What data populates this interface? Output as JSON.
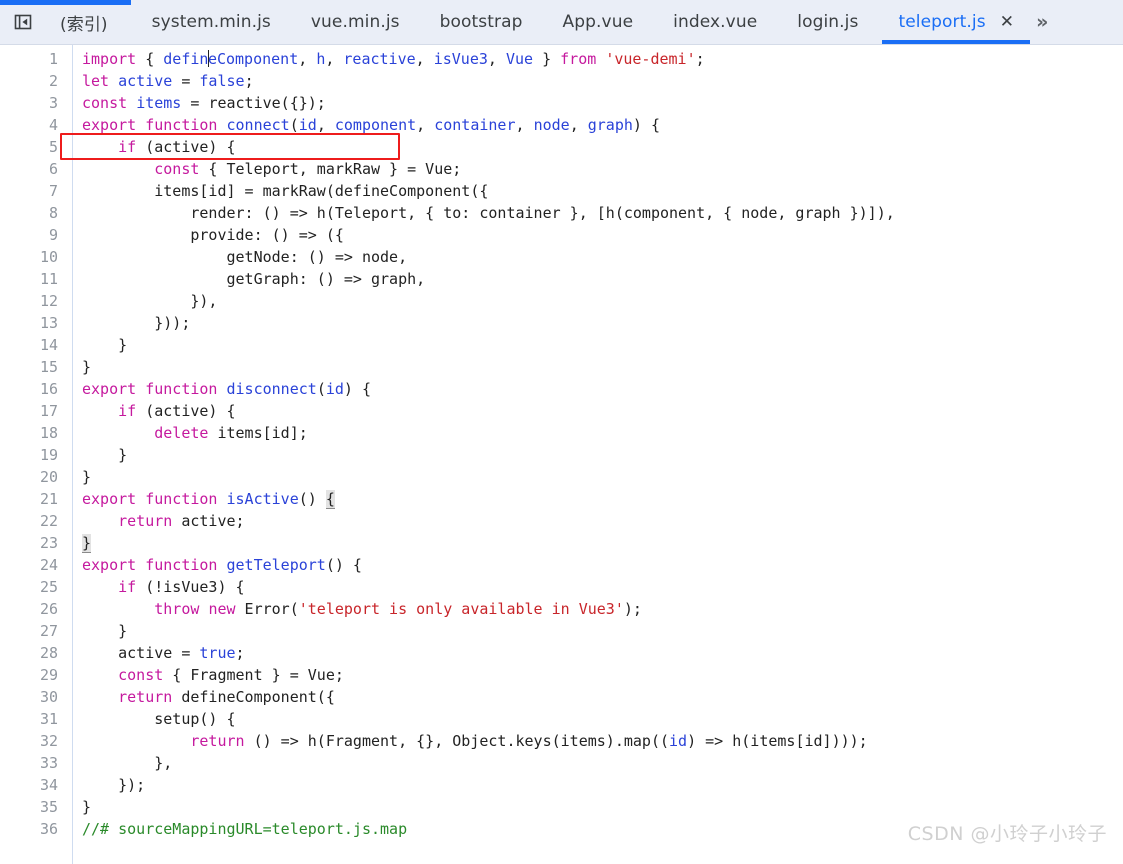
{
  "window": {
    "top_strip_color": "#1a6ef5",
    "tabbar_bg": "#eaeef7",
    "editor_bg": "#ffffff"
  },
  "toolbar": {
    "panel_toggle_name": "collapse-sidebar-icon"
  },
  "tabs": [
    {
      "label": "(索引)",
      "active": false,
      "cjk": true
    },
    {
      "label": "system.min.js",
      "active": false,
      "cjk": false
    },
    {
      "label": "vue.min.js",
      "active": false,
      "cjk": false
    },
    {
      "label": "bootstrap",
      "active": false,
      "cjk": false
    },
    {
      "label": "App.vue",
      "active": false,
      "cjk": false
    },
    {
      "label": "index.vue",
      "active": false,
      "cjk": false
    },
    {
      "label": "login.js",
      "active": false,
      "cjk": false
    },
    {
      "label": "teleport.js",
      "active": true,
      "cjk": false
    }
  ],
  "tab_close_label": "✕",
  "tab_overflow_label": "»",
  "editor": {
    "filename": "teleport.js",
    "language": "JavaScript",
    "line_count": 36,
    "cursor_line": 1,
    "cursor_column": 20,
    "highlighted_line": 3,
    "annotation_color": "#ee1c1c",
    "line_numbers": [
      1,
      2,
      3,
      4,
      5,
      6,
      7,
      8,
      9,
      10,
      11,
      12,
      13,
      14,
      15,
      16,
      17,
      18,
      19,
      20,
      21,
      22,
      23,
      24,
      25,
      26,
      27,
      28,
      29,
      30,
      31,
      32,
      33,
      34,
      35,
      36
    ],
    "lines": [
      "import { defineComponent, h, reactive, isVue3, Vue } from 'vue-demi';",
      "let active = false;",
      "const items = reactive({});",
      "export function connect(id, component, container, node, graph) {",
      "    if (active) {",
      "        const { Teleport, markRaw } = Vue;",
      "        items[id] = markRaw(defineComponent({",
      "            render: () => h(Teleport, { to: container }, [h(component, { node, graph })]),",
      "            provide: () => ({",
      "                getNode: () => node,",
      "                getGraph: () => graph,",
      "            }),",
      "        }));",
      "    }",
      "}",
      "export function disconnect(id) {",
      "    if (active) {",
      "        delete items[id];",
      "    }",
      "}",
      "export function isActive() {",
      "    return active;",
      "}",
      "export function getTeleport() {",
      "    if (!isVue3) {",
      "        throw new Error('teleport is only available in Vue3');",
      "    }",
      "    active = true;",
      "    const { Fragment } = Vue;",
      "    return defineComponent({",
      "        setup() {",
      "            return () => h(Fragment, {}, Object.keys(items).map((id) => h(items[id])));",
      "        },",
      "    });",
      "}",
      "//# sourceMappingURL=teleport.js.map"
    ]
  },
  "watermark": {
    "text": "CSDN @小玲子小玲子"
  }
}
